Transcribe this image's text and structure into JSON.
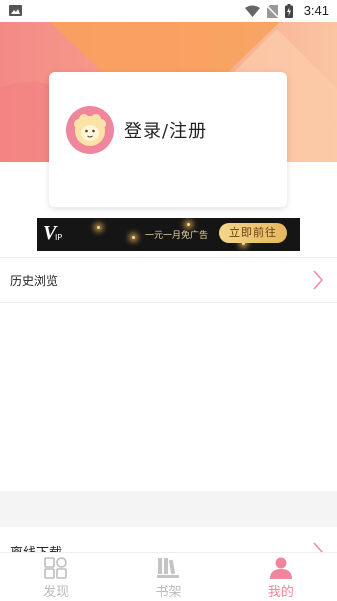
{
  "status_bar": {
    "time": "3:41"
  },
  "login": {
    "label": "登录/注册"
  },
  "vip_banner": {
    "vip_mark": "V",
    "vip_sub": "IP",
    "slogan": "一元一月免广告",
    "button_label": "立即前往"
  },
  "menu": [
    {
      "label": "历史浏览"
    },
    {
      "label": "离线下载"
    }
  ],
  "tabs": [
    {
      "label": "发现",
      "active": false
    },
    {
      "label": "书架",
      "active": false
    },
    {
      "label": "我的",
      "active": true
    }
  ],
  "colors": {
    "accent": "#f0869b",
    "inactive": "#bdbdbd"
  }
}
